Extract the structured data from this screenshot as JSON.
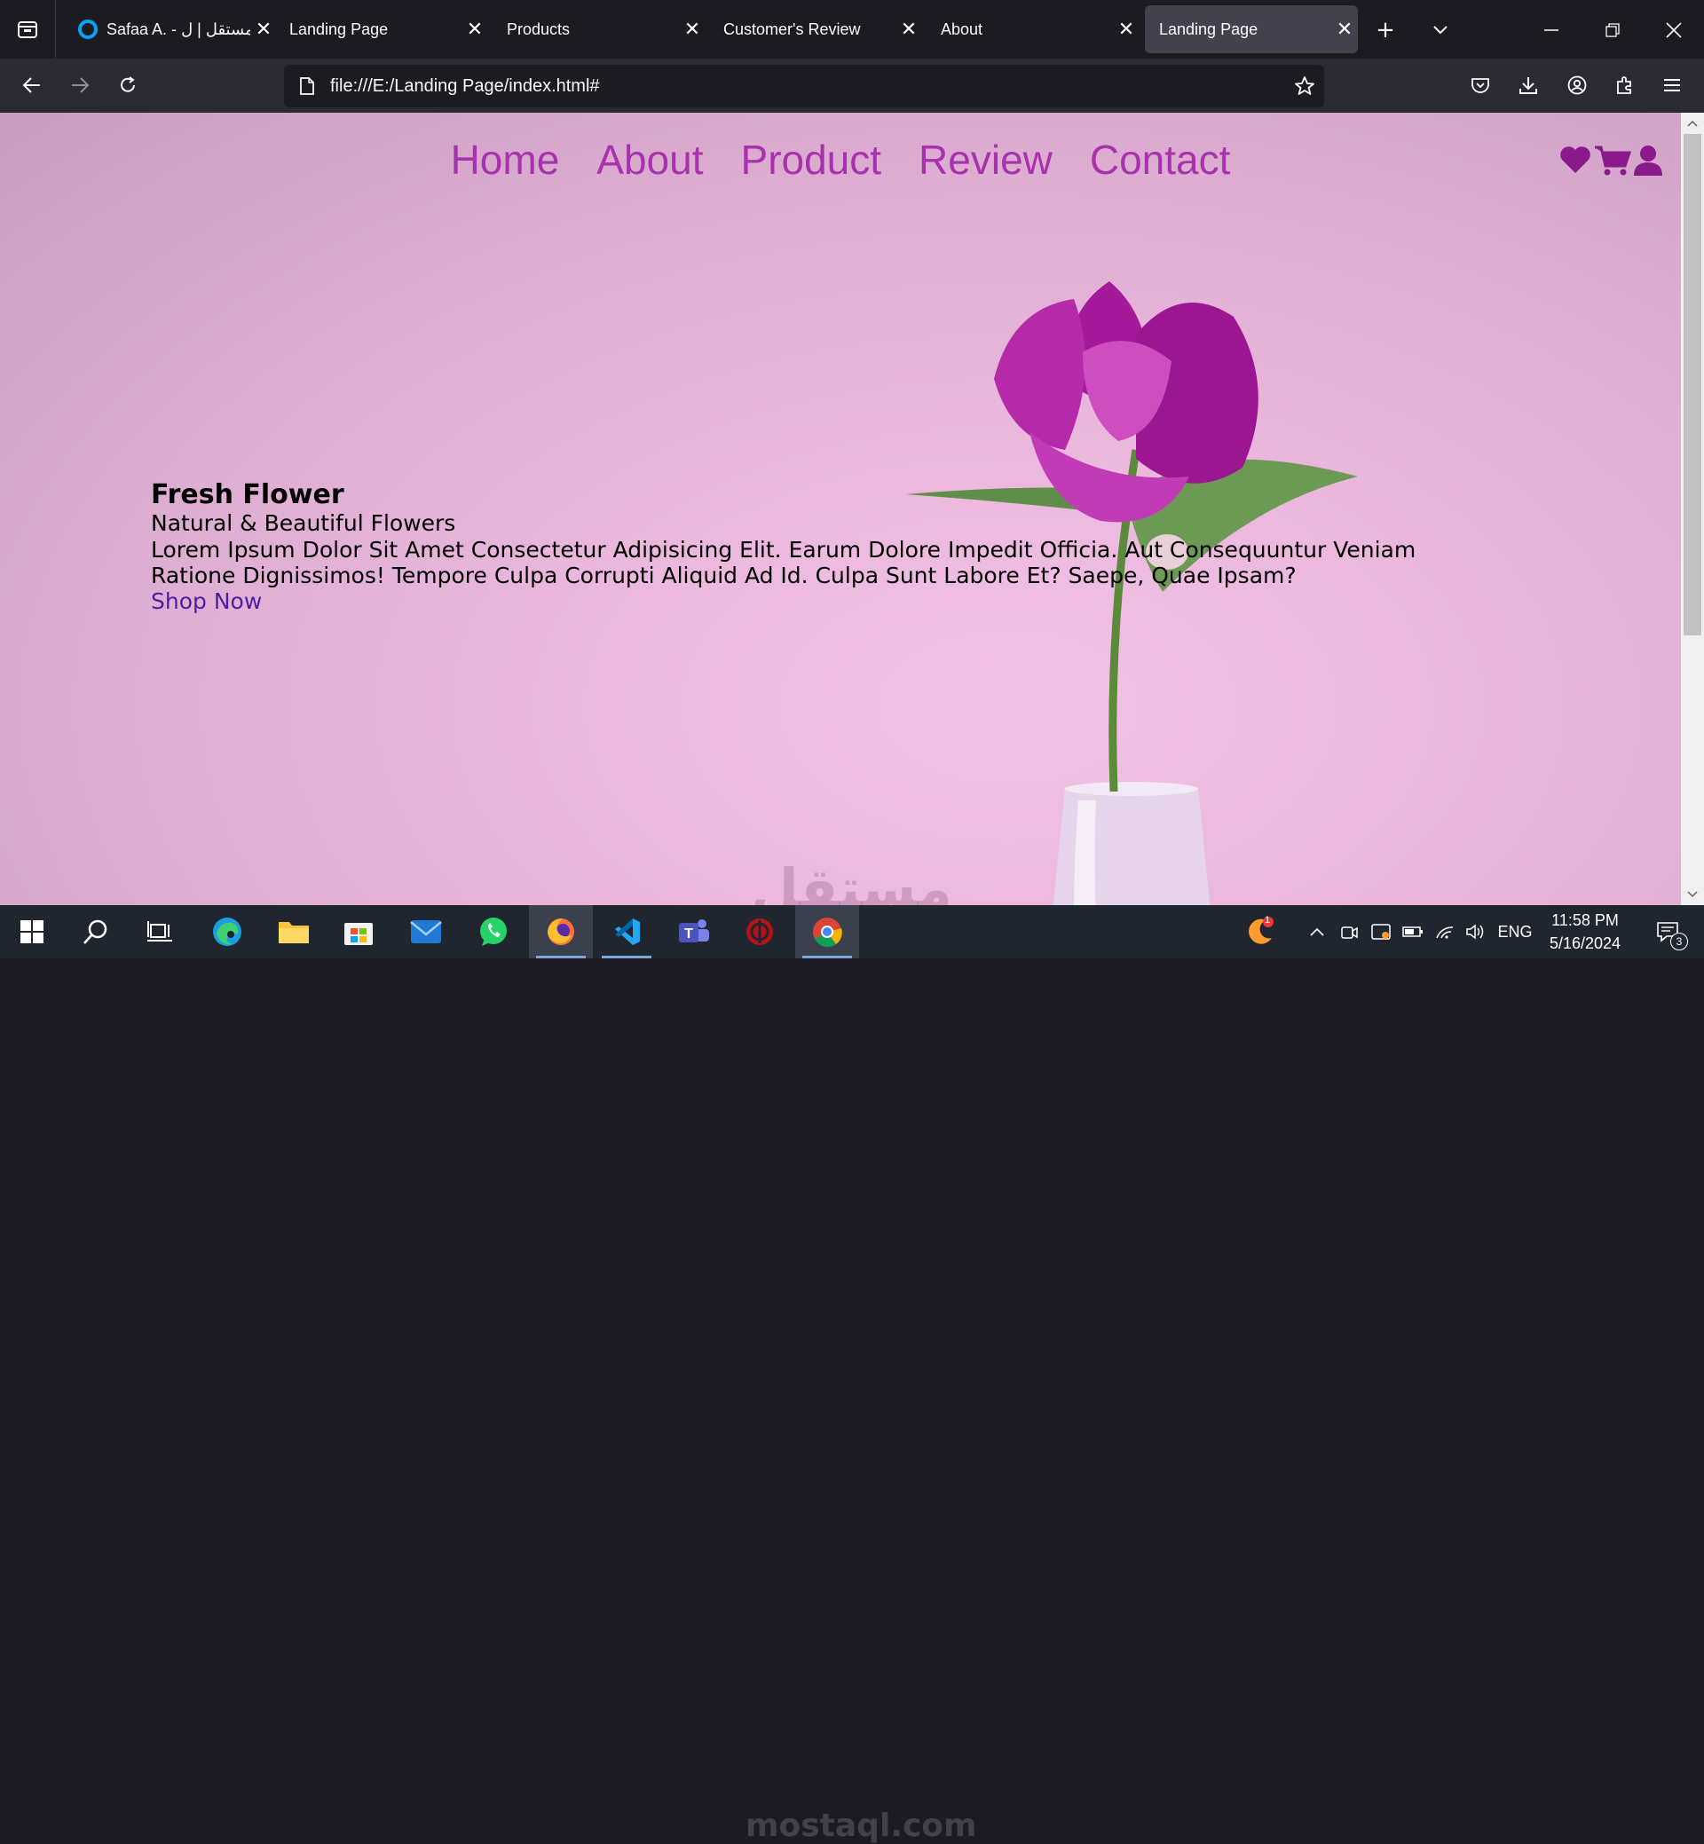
{
  "browser": {
    "tabs": [
      {
        "label": "Safaa A. - مستقل | ل",
        "active": false
      },
      {
        "label": "Landing Page",
        "active": false
      },
      {
        "label": "Products",
        "active": false
      },
      {
        "label": "Customer's Review",
        "active": false
      },
      {
        "label": "About",
        "active": false
      },
      {
        "label": "Landing Page",
        "active": true
      }
    ],
    "url": "file:///E:/Landing Page/index.html#"
  },
  "site": {
    "nav": [
      "Home",
      "About",
      "Product",
      "Review",
      "Contact"
    ],
    "hero": {
      "title": "Fresh Flower",
      "subtitle": "Natural & Beautiful Flowers",
      "body": "Lorem Ipsum Dolor Sit Amet Consectetur Adipisicing Elit. Earum Dolore Impedit Officia. Aut Consequuntur Veniam Ratione Dignissimos! Tempore Culpa Corrupti Aliquid Ad Id. Culpa Sunt Labore Et? Saepe, Quae Ipsam?",
      "cta": "Shop Now"
    },
    "colors": {
      "nav": "#a832ad",
      "cta": "#4c1f9e",
      "icons": "#8a1a8c"
    },
    "watermark": "مستقل"
  },
  "taskbar": {
    "language": "ENG",
    "time": "11:58 PM",
    "date": "5/16/2024",
    "notification_badge": "3",
    "firefox_badge": "1",
    "watermark": "mostaql.com"
  }
}
